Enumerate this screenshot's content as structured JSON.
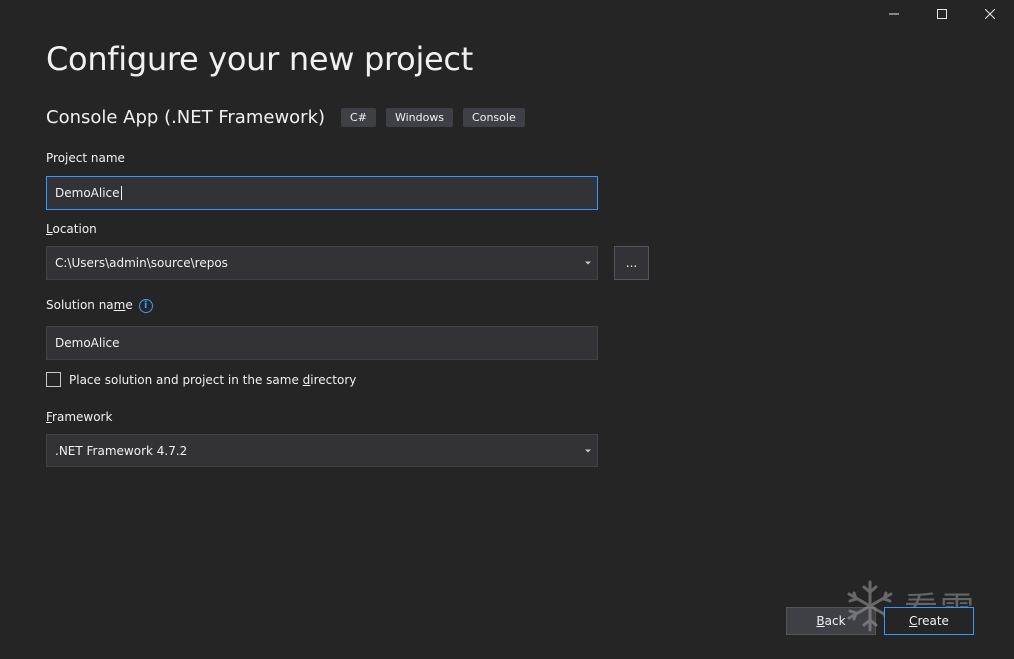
{
  "window": {
    "controls": {
      "minimize_icon": "minimize-icon",
      "maximize_icon": "maximize-icon",
      "close_icon": "close-icon"
    }
  },
  "page": {
    "title": "Configure your new project"
  },
  "template": {
    "name": "Console App (.NET Framework)",
    "tags": [
      "C#",
      "Windows",
      "Console"
    ]
  },
  "project_name": {
    "label": "Project name",
    "value": "DemoAlice"
  },
  "location": {
    "label_mnemonic": "L",
    "label_rest": "ocation",
    "value": "C:\\Users\\admin\\source\\repos",
    "browse_label": "..."
  },
  "solution_name": {
    "label_before": "Solution na",
    "label_mnemonic": "m",
    "label_after": "e",
    "value": "DemoAlice",
    "info_icon": "info-icon"
  },
  "same_directory": {
    "label_before": "Place solution and project in the same ",
    "label_mnemonic": "d",
    "label_after": "irectory",
    "checked": false
  },
  "framework": {
    "label_mnemonic": "F",
    "label_rest": "ramework",
    "value": ".NET Framework 4.7.2"
  },
  "footer": {
    "back_mnemonic": "B",
    "back_rest": "ack",
    "create_mnemonic": "C",
    "create_rest": "reate"
  },
  "watermark": {
    "text": "看雪",
    "icon": "snowflake-icon"
  },
  "colors": {
    "background": "#252526",
    "input_background": "#333337",
    "focus_border": "#3399ff",
    "info_blue": "#3e9cf5"
  }
}
